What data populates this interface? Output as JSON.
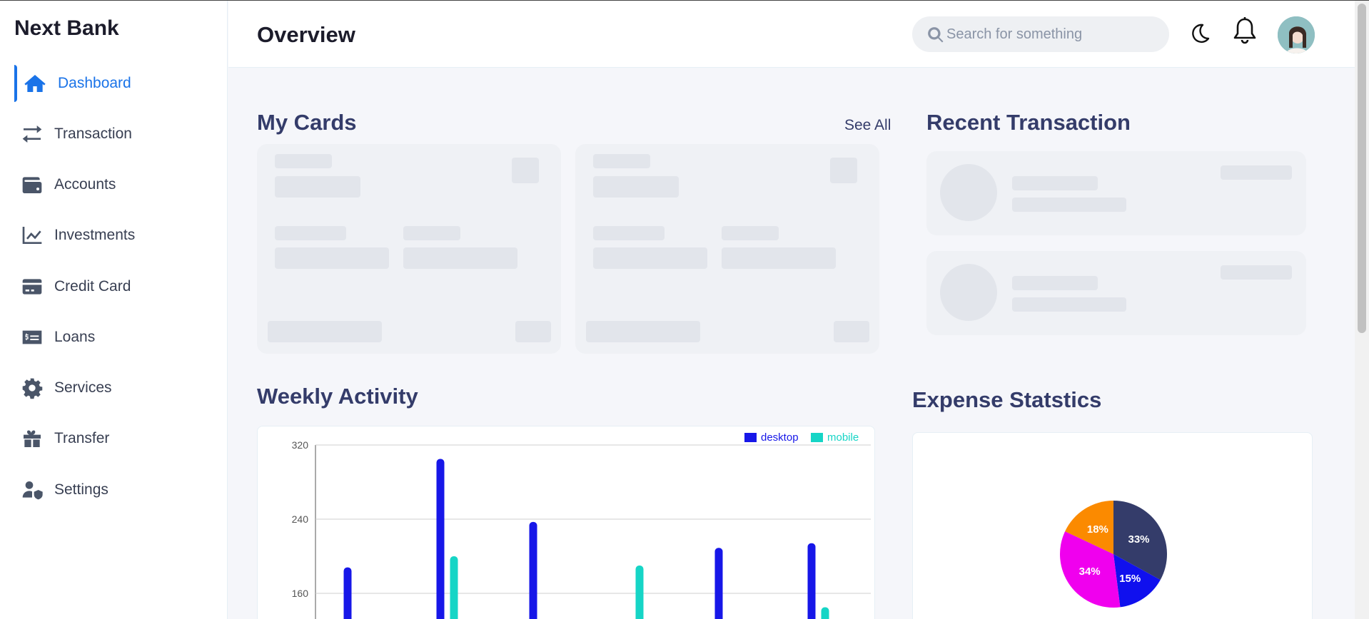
{
  "brand": {
    "name": "Next Bank"
  },
  "sidebar": {
    "items": [
      {
        "label": "Dashboard",
        "icon": "home-icon",
        "active": true
      },
      {
        "label": "Transaction",
        "icon": "transfer-arrows-icon"
      },
      {
        "label": "Accounts",
        "icon": "wallet-icon"
      },
      {
        "label": "Investments",
        "icon": "chart-line-icon"
      },
      {
        "label": "Credit Card",
        "icon": "credit-card-icon"
      },
      {
        "label": "Loans",
        "icon": "money-bill-icon"
      },
      {
        "label": "Services",
        "icon": "gear-icon"
      },
      {
        "label": "Transfer",
        "icon": "gift-icon"
      },
      {
        "label": "Settings",
        "icon": "user-shield-icon"
      }
    ]
  },
  "header": {
    "title": "Overview",
    "search_placeholder": "Search for something",
    "icons": [
      "search-icon",
      "moon-icon",
      "bell-icon",
      "avatar"
    ]
  },
  "cards": {
    "title": "My Cards",
    "see_all": "See All"
  },
  "transactions": {
    "title": "Recent Transaction"
  },
  "activity": {
    "title": "Weekly Activity"
  },
  "expense": {
    "title": "Expense Statstics"
  },
  "colors": {
    "accent": "#1a73e8",
    "desktop": "#1717e8",
    "mobile": "#16d5c6",
    "pie_navy": "#343c6a",
    "pie_blue": "#1010ee",
    "pie_magenta": "#f000ee",
    "pie_orange": "#fb8a00"
  },
  "chart_data": [
    {
      "type": "bar",
      "legend": [
        "desktop",
        "mobile"
      ],
      "legend_placement": "top-right",
      "ylim": [
        0,
        320
      ],
      "yticks": [
        160,
        240,
        320
      ],
      "grid": true,
      "series": [
        {
          "name": "desktop",
          "values": [
            188,
            305,
            237,
            0,
            209,
            214
          ]
        },
        {
          "name": "mobile",
          "values": [
            0,
            200,
            0,
            190,
            0,
            145
          ]
        }
      ]
    },
    {
      "type": "pie",
      "slices": [
        {
          "label": "33%",
          "value": 33,
          "color": "#343c6a"
        },
        {
          "label": "15%",
          "value": 15,
          "color": "#1010ee"
        },
        {
          "label": "34%",
          "value": 34,
          "color": "#f000ee"
        },
        {
          "label": "18%",
          "value": 18,
          "color": "#fb8a00"
        }
      ]
    }
  ]
}
